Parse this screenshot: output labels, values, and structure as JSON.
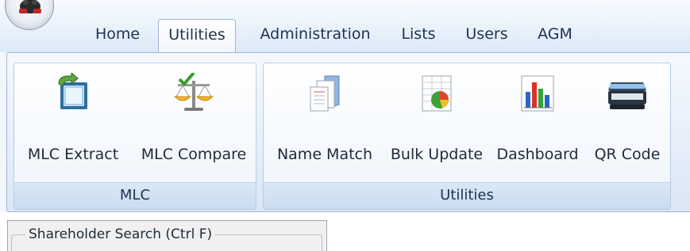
{
  "ribbon": {
    "tabs": [
      {
        "label": "Home",
        "active": false
      },
      {
        "label": "Utilities",
        "active": true
      },
      {
        "label": "Administration",
        "active": false
      },
      {
        "label": "Lists",
        "active": false
      },
      {
        "label": "Users",
        "active": false
      },
      {
        "label": "AGM",
        "active": false
      }
    ],
    "groups": [
      {
        "caption": "MLC",
        "buttons": [
          {
            "label": "MLC Extract",
            "icon": "mlc-extract-icon"
          },
          {
            "label": "MLC Compare",
            "icon": "scales-check-icon"
          }
        ]
      },
      {
        "caption": "Utilities",
        "buttons": [
          {
            "label": "Name Match",
            "icon": "documents-icon"
          },
          {
            "label": "Bulk Update",
            "icon": "spreadsheet-pie-icon"
          },
          {
            "label": "Dashboard",
            "icon": "bar-chart-icon"
          },
          {
            "label": "QR Code",
            "icon": "scanner-icon"
          }
        ]
      }
    ]
  },
  "panel": {
    "groupbox_title": "Shareholder Search (Ctrl F)"
  },
  "colors": {
    "ribbon_border": "#9fb6d1",
    "caption_bg": "#cbdcf0",
    "text": "#1e3250"
  }
}
